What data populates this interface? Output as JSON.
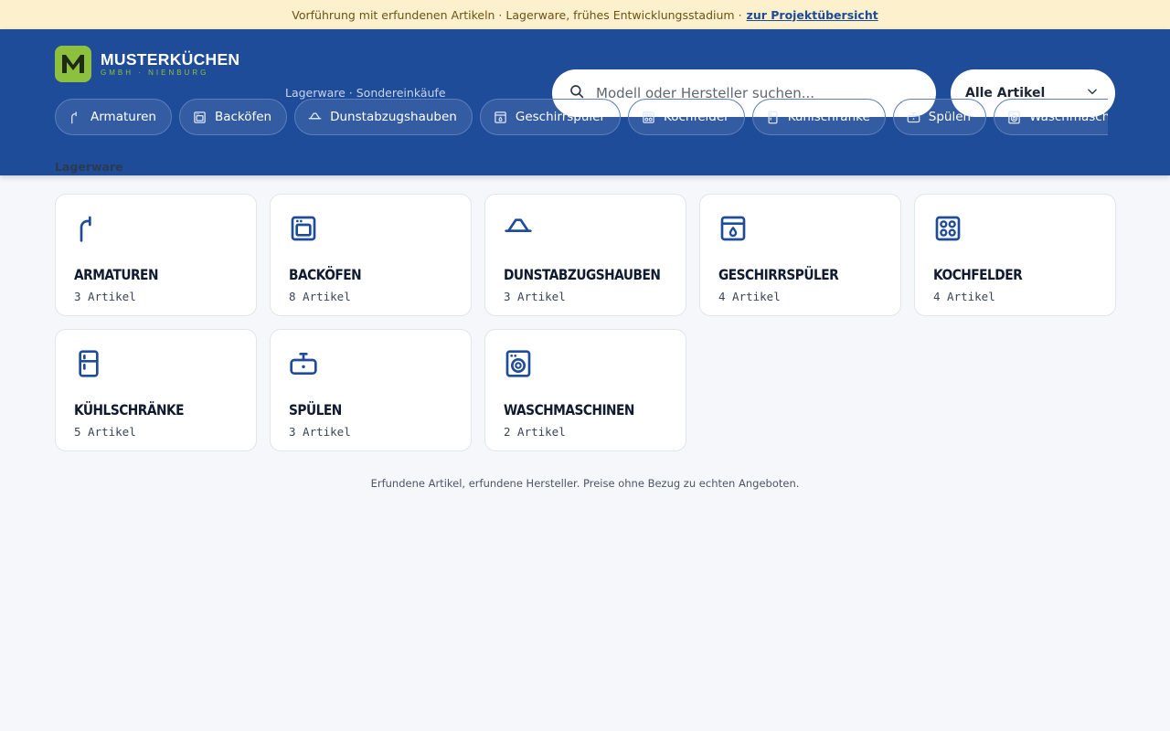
{
  "notice": {
    "text": "Vorführung mit erfundenen Artikeln · Lagerware, frühes Entwicklungsstadium ·",
    "link": "zur Projektübersicht"
  },
  "header": {
    "brand_name": "MUSTERKÜCHEN",
    "brand_sub": "GMBH · NIENBURG",
    "tagline": "Lagerware · Sondereinkäufe",
    "search_placeholder": "Modell oder Hersteller suchen...",
    "filter_selected": "Alle Artikel"
  },
  "chips": [
    {
      "label": "Armaturen",
      "icon": "faucet-icon"
    },
    {
      "label": "Backöfen",
      "icon": "oven-icon"
    },
    {
      "label": "Dunstabzugshauben",
      "icon": "hood-icon"
    },
    {
      "label": "Geschirrspüler",
      "icon": "dishwasher-icon"
    },
    {
      "label": "Kochfelder",
      "icon": "cooktop-icon"
    },
    {
      "label": "Kühlschränke",
      "icon": "fridge-icon"
    },
    {
      "label": "Spülen",
      "icon": "sink-icon"
    },
    {
      "label": "Waschmaschinen",
      "icon": "washing-machine-icon"
    }
  ],
  "breadcrumb": "Lagerware",
  "categories": [
    {
      "title": "Armaturen",
      "count": "3 Artikel",
      "icon": "faucet-icon"
    },
    {
      "title": "Backöfen",
      "count": "8 Artikel",
      "icon": "oven-icon"
    },
    {
      "title": "Dunstabzugshauben",
      "count": "3 Artikel",
      "icon": "hood-icon"
    },
    {
      "title": "Geschirrspüler",
      "count": "4 Artikel",
      "icon": "dishwasher-icon"
    },
    {
      "title": "Kochfelder",
      "count": "4 Artikel",
      "icon": "cooktop-icon"
    },
    {
      "title": "Kühlschränke",
      "count": "5 Artikel",
      "icon": "fridge-icon"
    },
    {
      "title": "Spülen",
      "count": "3 Artikel",
      "icon": "sink-icon"
    },
    {
      "title": "Waschmaschinen",
      "count": "2 Artikel",
      "icon": "washing-machine-icon"
    }
  ],
  "footnote": "Erfundene Artikel, erfundene Hersteller. Preise ohne Bezug zu echten Angeboten.",
  "colors": {
    "header": "#1f4c99",
    "accent_green": "#8ec03f",
    "notice_bg": "#fdf1cd",
    "icon_blue": "#1f4c99"
  }
}
